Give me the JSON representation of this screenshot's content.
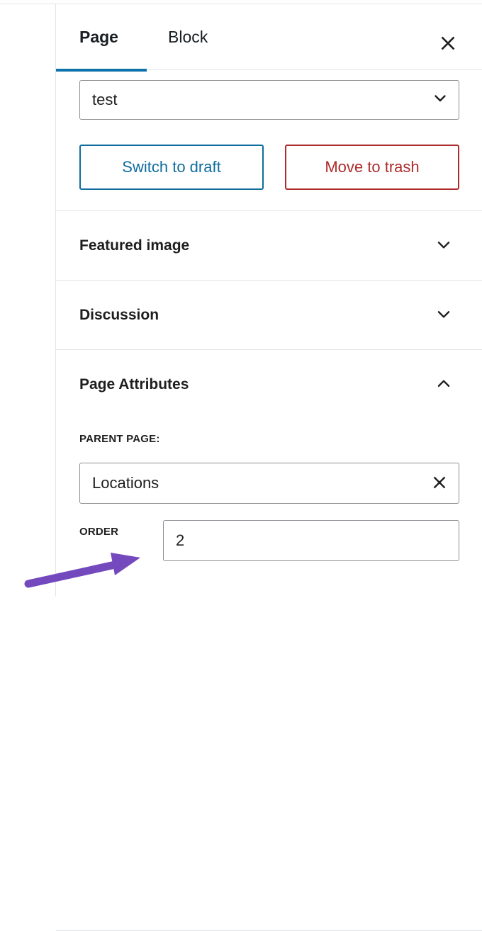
{
  "sidebar": {
    "tabs": [
      {
        "label": "Page",
        "active": true
      },
      {
        "label": "Block",
        "active": false
      }
    ],
    "close_label": "Close settings",
    "status": {
      "select_value": "test",
      "actions": [
        {
          "label": "Switch to draft",
          "color": "#0f6d9e"
        },
        {
          "label": "Move to trash",
          "color": "#ae2b2b"
        }
      ]
    },
    "panels": [
      {
        "title": "Featured image",
        "expanded": false,
        "icon": "chevron-down-icon"
      },
      {
        "title": "Discussion",
        "expanded": false,
        "icon": "chevron-down-icon"
      },
      {
        "title": "Page Attributes",
        "expanded": true,
        "icon": "chevron-up-icon"
      }
    ],
    "page_attributes": {
      "parent_label": "PARENT PAGE:",
      "parent_value": "Locations",
      "parent_placeholder": "",
      "clear_label": "Clear",
      "order_label": "ORDER",
      "order_value": "2",
      "order_placeholder": ""
    }
  },
  "annotation": {
    "arrow_color": "#7349bd",
    "points_to": "ORDER"
  },
  "colors": {
    "accent_blue": "#0e72ab",
    "destructive_red": "#ae2b2b",
    "border_gray": "#e2e4e7",
    "input_border": "#8d8f94",
    "text": "#1e1e1e"
  }
}
